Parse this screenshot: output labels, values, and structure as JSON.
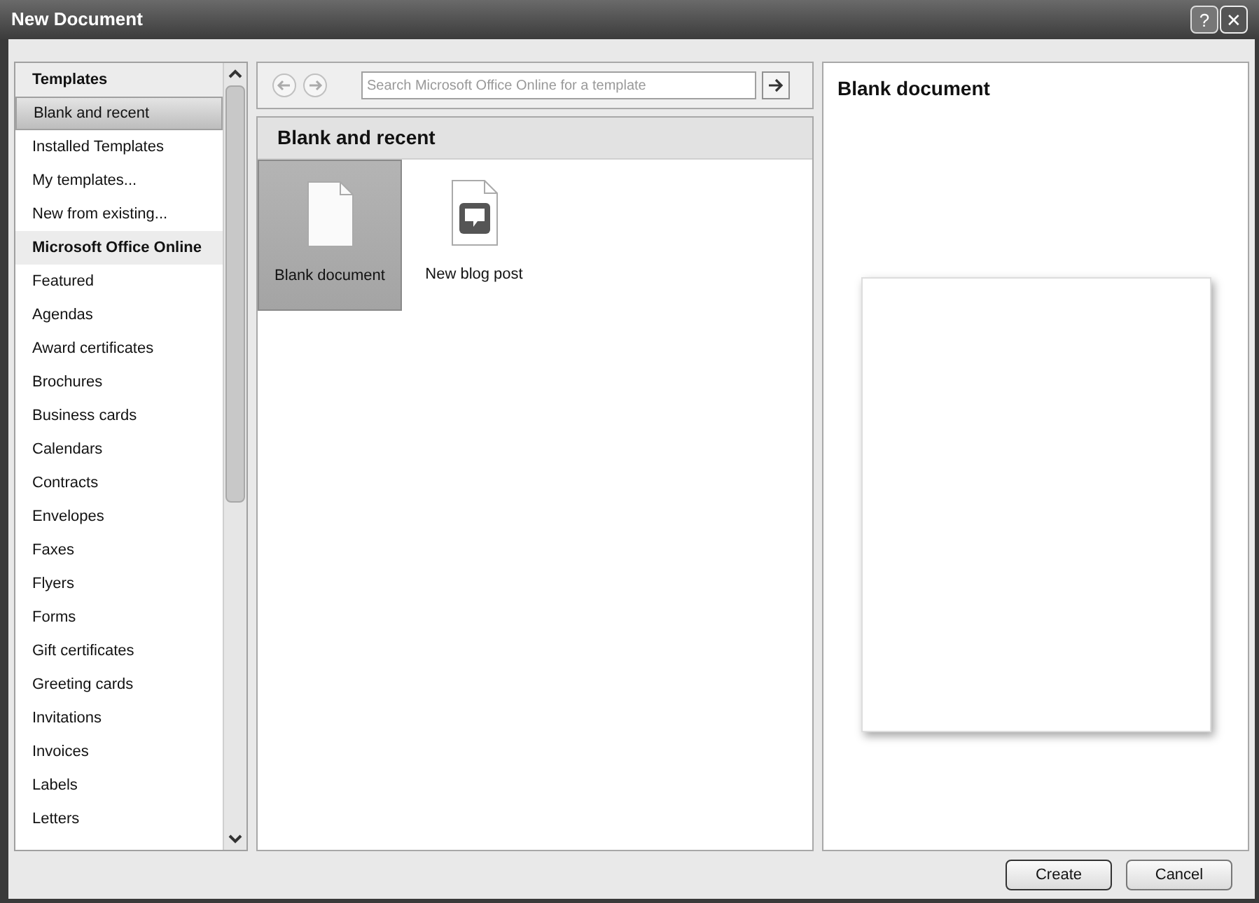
{
  "window": {
    "title": "New Document",
    "buttons": [
      {
        "kind": "help",
        "label": "?"
      },
      {
        "kind": "close",
        "label": "✕"
      }
    ]
  },
  "sidebar": {
    "items": [
      {
        "kind": "header",
        "label": "Templates"
      },
      {
        "kind": "item",
        "label": "Blank and recent",
        "selected": true
      },
      {
        "kind": "item",
        "label": "Installed Templates",
        "selected": false
      },
      {
        "kind": "item",
        "label": "My templates...",
        "selected": false
      },
      {
        "kind": "item",
        "label": "New from existing...",
        "selected": false
      },
      {
        "kind": "header",
        "label": "Microsoft Office Online"
      },
      {
        "kind": "item",
        "label": "Featured",
        "selected": false
      },
      {
        "kind": "item",
        "label": "Agendas",
        "selected": false
      },
      {
        "kind": "item",
        "label": "Award certificates",
        "selected": false
      },
      {
        "kind": "item",
        "label": "Brochures",
        "selected": false
      },
      {
        "kind": "item",
        "label": "Business cards",
        "selected": false
      },
      {
        "kind": "item",
        "label": "Calendars",
        "selected": false
      },
      {
        "kind": "item",
        "label": "Contracts",
        "selected": false
      },
      {
        "kind": "item",
        "label": "Envelopes",
        "selected": false
      },
      {
        "kind": "item",
        "label": "Faxes",
        "selected": false
      },
      {
        "kind": "item",
        "label": "Flyers",
        "selected": false
      },
      {
        "kind": "item",
        "label": "Forms",
        "selected": false
      },
      {
        "kind": "item",
        "label": "Gift certificates",
        "selected": false
      },
      {
        "kind": "item",
        "label": "Greeting cards",
        "selected": false
      },
      {
        "kind": "item",
        "label": "Invitations",
        "selected": false
      },
      {
        "kind": "item",
        "label": "Invoices",
        "selected": false
      },
      {
        "kind": "item",
        "label": "Labels",
        "selected": false
      },
      {
        "kind": "item",
        "label": "Letters",
        "selected": false
      }
    ]
  },
  "search": {
    "placeholder": "Search Microsoft Office Online for a template"
  },
  "gallery": {
    "title": "Blank and recent",
    "items": [
      {
        "kind": "blank",
        "label": "Blank document",
        "selected": true
      },
      {
        "kind": "blog",
        "label": "New blog post",
        "selected": false
      }
    ]
  },
  "preview": {
    "title": "Blank document"
  },
  "buttons": [
    "Create",
    "Cancel"
  ]
}
